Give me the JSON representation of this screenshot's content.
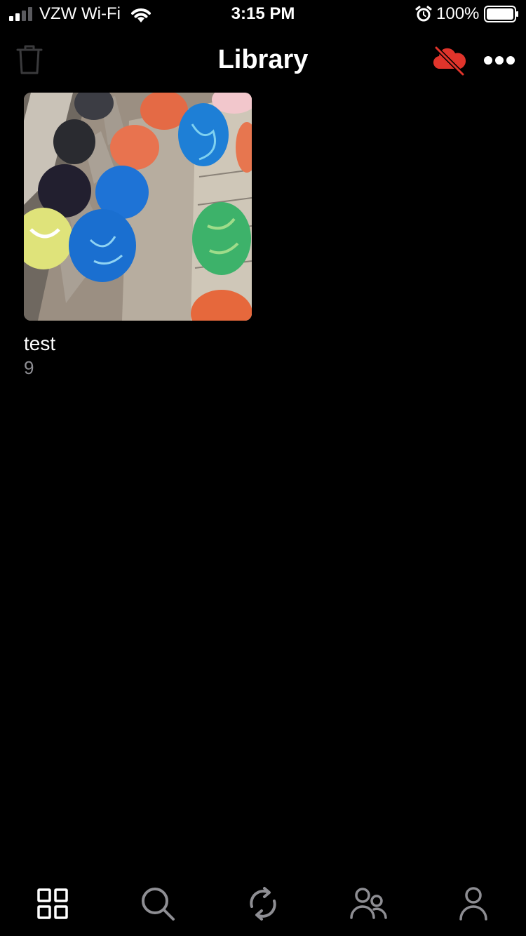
{
  "status_bar": {
    "carrier": "VZW Wi-Fi",
    "time": "3:15 PM",
    "battery": "100%"
  },
  "nav": {
    "title": "Library",
    "left_icon": "trash-icon",
    "right_icons": [
      "cloud-off-icon",
      "more-icon"
    ]
  },
  "albums": [
    {
      "name": "test",
      "count": "9",
      "thumbnail": "easter-eggs-photo"
    }
  ],
  "tab_bar": {
    "tabs": [
      {
        "icon": "grid-icon",
        "selected": true
      },
      {
        "icon": "search-icon",
        "selected": false
      },
      {
        "icon": "sync-icon",
        "selected": false
      },
      {
        "icon": "people-icon",
        "selected": false
      },
      {
        "icon": "person-icon",
        "selected": false
      }
    ]
  },
  "colors": {
    "background": "#000000",
    "accent_red": "#e0342b",
    "inactive_icon": "#8e8e93",
    "dim_icon": "#3a3a3c",
    "text": "#ffffff",
    "secondary_text": "#8e8e93"
  }
}
